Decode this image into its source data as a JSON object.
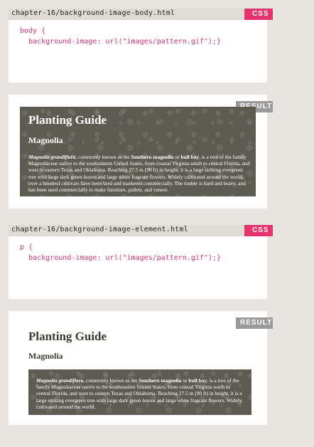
{
  "example1": {
    "filename": "chapter-16/background-image-body.html",
    "tag": "CSS",
    "code_line1": "body {",
    "code_line2": "  background-image: url(\"images/pattern.gif\");}"
  },
  "result1": {
    "tag": "RESULT",
    "heading": "Planting Guide",
    "subheading": "Magnolia",
    "paragraph": {
      "species": "Magnolia grandiflora",
      "text1": ", commonly known as the ",
      "common_name": "Southern magnolia",
      "text2": " or ",
      "alt_name": "bull bay",
      "text3": ", is a tree of the family Magnoliaceae native to the southeastern United States, from coastal Virginia south to central Florida, and west to eastern Texas and Oklahoma. Reaching 27.5 m (90 ft) in height, it is a large striking evergreen tree with large dark green leaves and large white fragrant flowers. Widely cultivated around the world, over a hundred cultivars have been bred and marketed commercially. The timber is hard and heavy, and has been used commercially to make furniture, pallets, and veneer."
    }
  },
  "example2": {
    "filename": "chapter-16/background-image-element.html",
    "tag": "CSS",
    "code_line1": "p {",
    "code_line2": "  background-image: url(\"images/pattern.gif\");}"
  },
  "result2": {
    "tag": "RESULT",
    "heading": "Planting Guide",
    "subheading": "Magnolia",
    "paragraph": {
      "species": "Magnolia grandiflora",
      "text1": ", commonly known as the ",
      "common_name": "Southern magnolia",
      "text2": " or ",
      "alt_name": "bull bay",
      "text3": ", is a tree of the family Magnoliaceae native to the southeastern United States, from coastal Virginia south to central Florida, and west to eastern Texas and Oklahoma. Reaching 27.5 m (90 ft) in height, it is a large striking evergreen tree with large dark green leaves and large white fragrant flowers. Widely cultivated around the world."
    }
  },
  "colors": {
    "page_background": "#e8e5e0",
    "header_bar": "#dfdbd5",
    "css_tag": "#e5336e",
    "result_tag": "#9a9a9a",
    "code_text": "#d6336d",
    "pattern_base": "#5d5c52"
  }
}
